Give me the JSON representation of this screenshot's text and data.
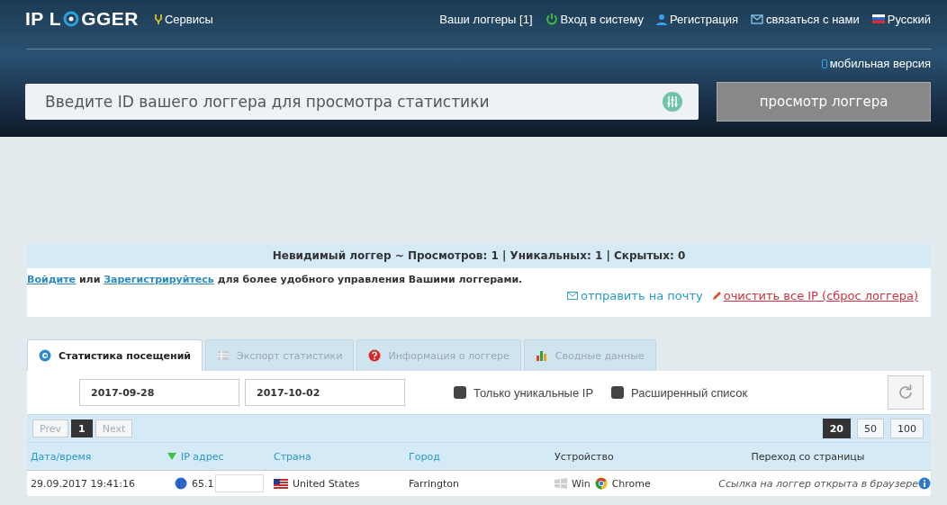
{
  "header": {
    "logo": {
      "before": "IP L",
      "after": "GGER"
    },
    "services": "Сервисы",
    "nav": [
      {
        "kind": "loggers",
        "label": "Ваши логгеры [1]"
      },
      {
        "kind": "login",
        "label": "Вход в систему"
      },
      {
        "kind": "register",
        "label": "Регистрация"
      },
      {
        "kind": "contact",
        "label": "связаться с нами"
      },
      {
        "kind": "language",
        "label": "Русский"
      }
    ],
    "mobile": "мобильная версия",
    "search": {
      "placeholder": "Введите ID вашего логгера для просмотра статистики",
      "button": "просмотр логгера"
    }
  },
  "summary": "Невидимый логгер ~ Просмотров: 1 | Уникальных: 1 | Скрытых: 0",
  "notice": [
    {
      "text": "Войдите",
      "link": true
    },
    {
      "text": " или ",
      "link": false
    },
    {
      "text": "Зарегистрируйтесь",
      "link": true
    },
    {
      "text": " для более удобного управления Вашими логгерами.",
      "link": false
    }
  ],
  "actions": [
    {
      "kind": "mail",
      "label": "отправить на почту"
    },
    {
      "kind": "clear",
      "label": "очистить все IP (сброс логгера)"
    }
  ],
  "tabs": [
    {
      "kind": "stats",
      "label": "Статистика посещений",
      "selected": true
    },
    {
      "kind": "export",
      "label": "Экспорт статистики",
      "selected": false
    },
    {
      "kind": "info",
      "label": "Информация о логгере",
      "selected": false
    },
    {
      "kind": "summary",
      "label": "Сводные данные",
      "selected": false
    }
  ],
  "filters": {
    "date_from": "2017-09-28",
    "date_to": "2017-10-02",
    "checkboxes": [
      {
        "label": "Только уникальные IP",
        "checked": false
      },
      {
        "label": "Расширенный список",
        "checked": false
      }
    ]
  },
  "pager": {
    "prev": {
      "label": "Prev",
      "disabled": true
    },
    "pages": [
      {
        "label": "1",
        "selected": true
      }
    ],
    "next": {
      "label": "Next",
      "disabled": true
    },
    "sizes": [
      {
        "label": "20",
        "selected": true
      },
      {
        "label": "50",
        "selected": false
      },
      {
        "label": "100",
        "selected": false
      }
    ]
  },
  "table": {
    "columns": [
      {
        "label": "Дата/время",
        "link": true,
        "sorted": false
      },
      {
        "label": "IP адрес",
        "link": true,
        "sorted": true
      },
      {
        "label": "Страна",
        "link": true,
        "sorted": false
      },
      {
        "label": "Город",
        "link": true,
        "sorted": false
      },
      {
        "label": "Устройство",
        "link": false,
        "sorted": false
      },
      {
        "label": "Переход со страницы",
        "link": false,
        "sorted": false
      }
    ],
    "rows": [
      {
        "datetime": "29.09.2017 19:41:16",
        "ip": "65.1",
        "country": "United States",
        "city": "Farrington",
        "os": "Win",
        "browser": "Chrome",
        "referrer": "Ссылка на логгер открыта в браузере"
      }
    ]
  }
}
